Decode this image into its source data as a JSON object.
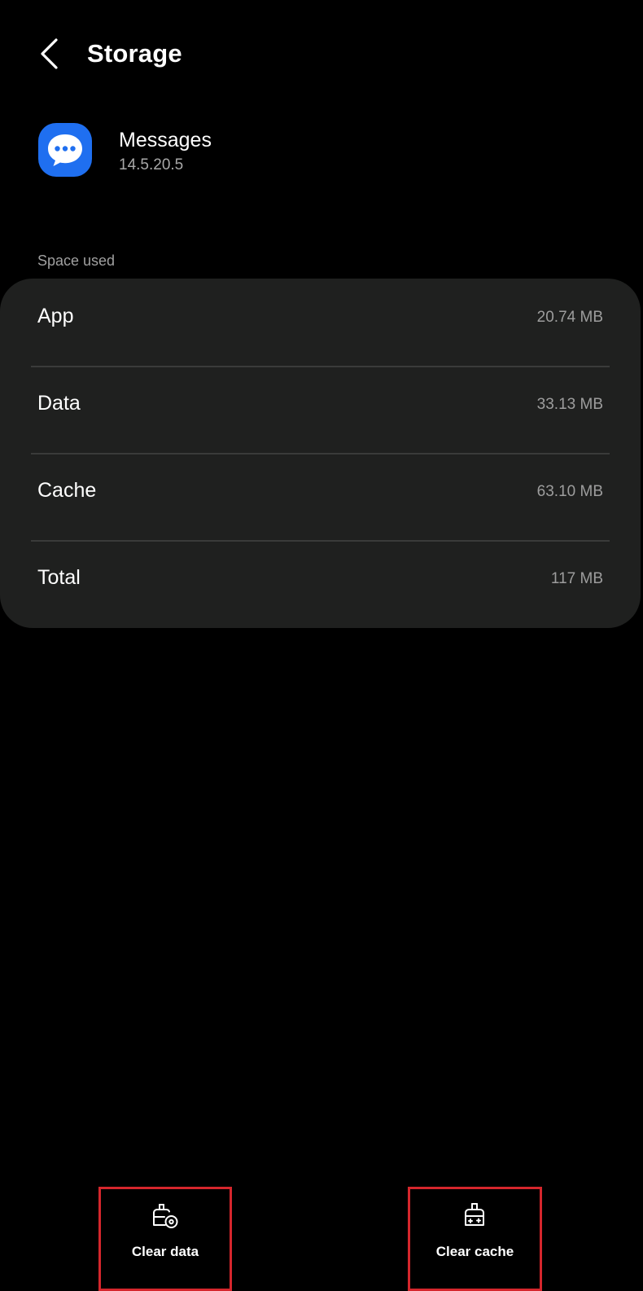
{
  "header": {
    "back_icon": "chevron-left-icon",
    "title": "Storage"
  },
  "app": {
    "icon": "messages-app-icon",
    "name": "Messages",
    "version": "14.5.20.5"
  },
  "space_used": {
    "label": "Space used",
    "rows": [
      {
        "label": "App",
        "value": "20.74 MB"
      },
      {
        "label": "Data",
        "value": "33.13 MB"
      },
      {
        "label": "Cache",
        "value": "63.10 MB"
      },
      {
        "label": "Total",
        "value": "117 MB"
      }
    ]
  },
  "actions": {
    "clear_data": {
      "label": "Clear data",
      "icon": "clear-data-icon"
    },
    "clear_cache": {
      "label": "Clear cache",
      "icon": "clear-cache-icon"
    }
  },
  "colors": {
    "background": "#000000",
    "card": "#1f201f",
    "app_icon_blue": "#1f6ff0",
    "highlight_border": "#d5262c"
  }
}
